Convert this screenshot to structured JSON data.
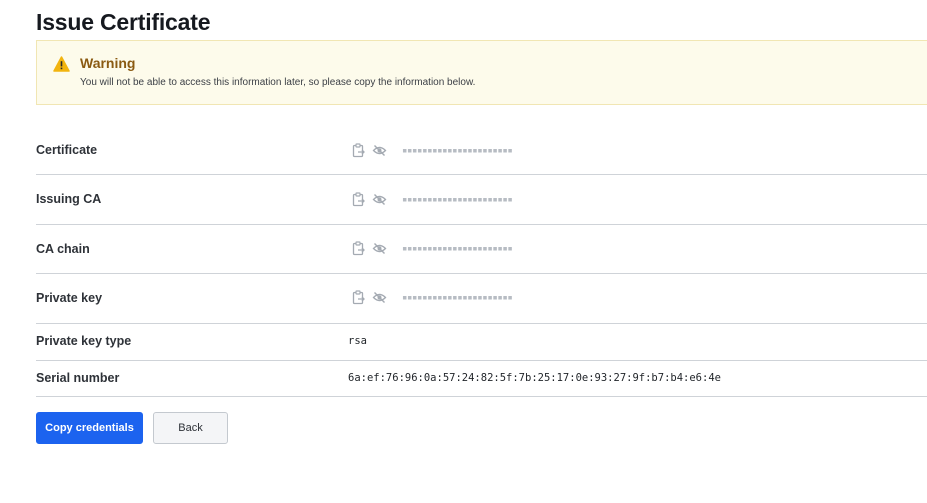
{
  "page": {
    "title": "Issue Certificate"
  },
  "warning": {
    "title": "Warning",
    "message": "You will not be able to access this information later, so please copy the information below."
  },
  "masked_placeholder": "▪▪▪▪▪▪▪▪▪▪▪▪▪▪▪▪▪▪▪▪▪▪",
  "fields": {
    "certificate": {
      "label": "Certificate"
    },
    "issuing_ca": {
      "label": "Issuing CA"
    },
    "ca_chain": {
      "label": "CA chain"
    },
    "private_key": {
      "label": "Private key"
    },
    "private_key_type": {
      "label": "Private key type",
      "value": "rsa"
    },
    "serial_number": {
      "label": "Serial number",
      "value": "6a:ef:76:96:0a:57:24:82:5f:7b:25:17:0e:93:27:9f:b7:b4:e6:4e"
    }
  },
  "buttons": {
    "copy_credentials": "Copy credentials",
    "back": "Back"
  },
  "icons": {
    "warning": "warning-triangle-icon",
    "copy": "clipboard-copy-icon",
    "reveal": "eye-slash-icon"
  },
  "colors": {
    "primary": "#1c63ef",
    "warning_bg": "#fdfbeb",
    "warning_title": "#8a5a12",
    "warning_icon": "#f2b40f"
  }
}
